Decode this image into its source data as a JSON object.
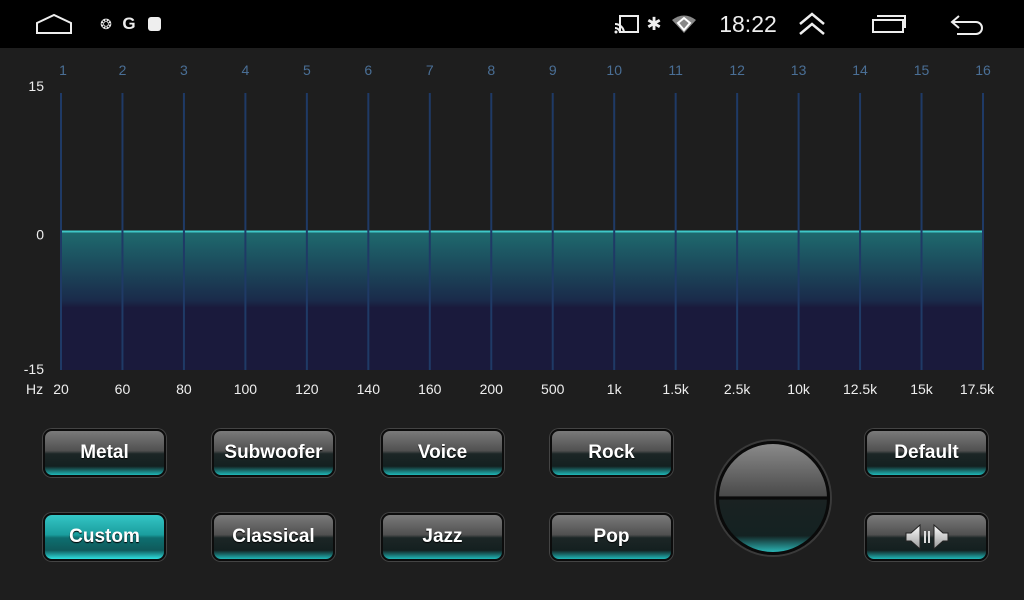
{
  "status_bar": {
    "time": "18:22",
    "icons": [
      "home-icon",
      "pinwheel-icon",
      "google-icon",
      "square-app-icon",
      "cast-icon",
      "bluetooth-icon",
      "wifi-icon",
      "collapse-up-icon",
      "recent-apps-icon",
      "back-icon"
    ],
    "g_label": "G"
  },
  "chart_data": {
    "type": "area",
    "band_numbers": [
      "1",
      "2",
      "3",
      "4",
      "5",
      "6",
      "7",
      "8",
      "9",
      "10",
      "11",
      "12",
      "13",
      "14",
      "15",
      "16"
    ],
    "categories": [
      "20",
      "60",
      "80",
      "100",
      "120",
      "140",
      "160",
      "200",
      "500",
      "1k",
      "1.5k",
      "2.5k",
      "10k",
      "12.5k",
      "15k",
      "17.5k"
    ],
    "values": [
      0,
      0,
      0,
      0,
      0,
      0,
      0,
      0,
      0,
      0,
      0,
      0,
      0,
      0,
      0,
      0
    ],
    "xlabel": "Hz",
    "ylim": [
      -15,
      15
    ],
    "yticks": [
      "15",
      "0",
      "-15"
    ],
    "colors": {
      "fill_top": "#1e6a6e",
      "fill_bottom": "#1a1a3c",
      "line": "#3fc8c8",
      "band": "#1f3a66",
      "band_label": "#4a6f96"
    }
  },
  "presets": [
    {
      "label": "Metal",
      "selected": false
    },
    {
      "label": "Subwoofer",
      "selected": false
    },
    {
      "label": "Voice",
      "selected": false
    },
    {
      "label": "Rock",
      "selected": false
    },
    {
      "label": "Custom",
      "selected": true
    },
    {
      "label": "Classical",
      "selected": false
    },
    {
      "label": "Jazz",
      "selected": false
    },
    {
      "label": "Pop",
      "selected": false
    }
  ],
  "default_label": "Default",
  "accent": "#1fb8b8"
}
